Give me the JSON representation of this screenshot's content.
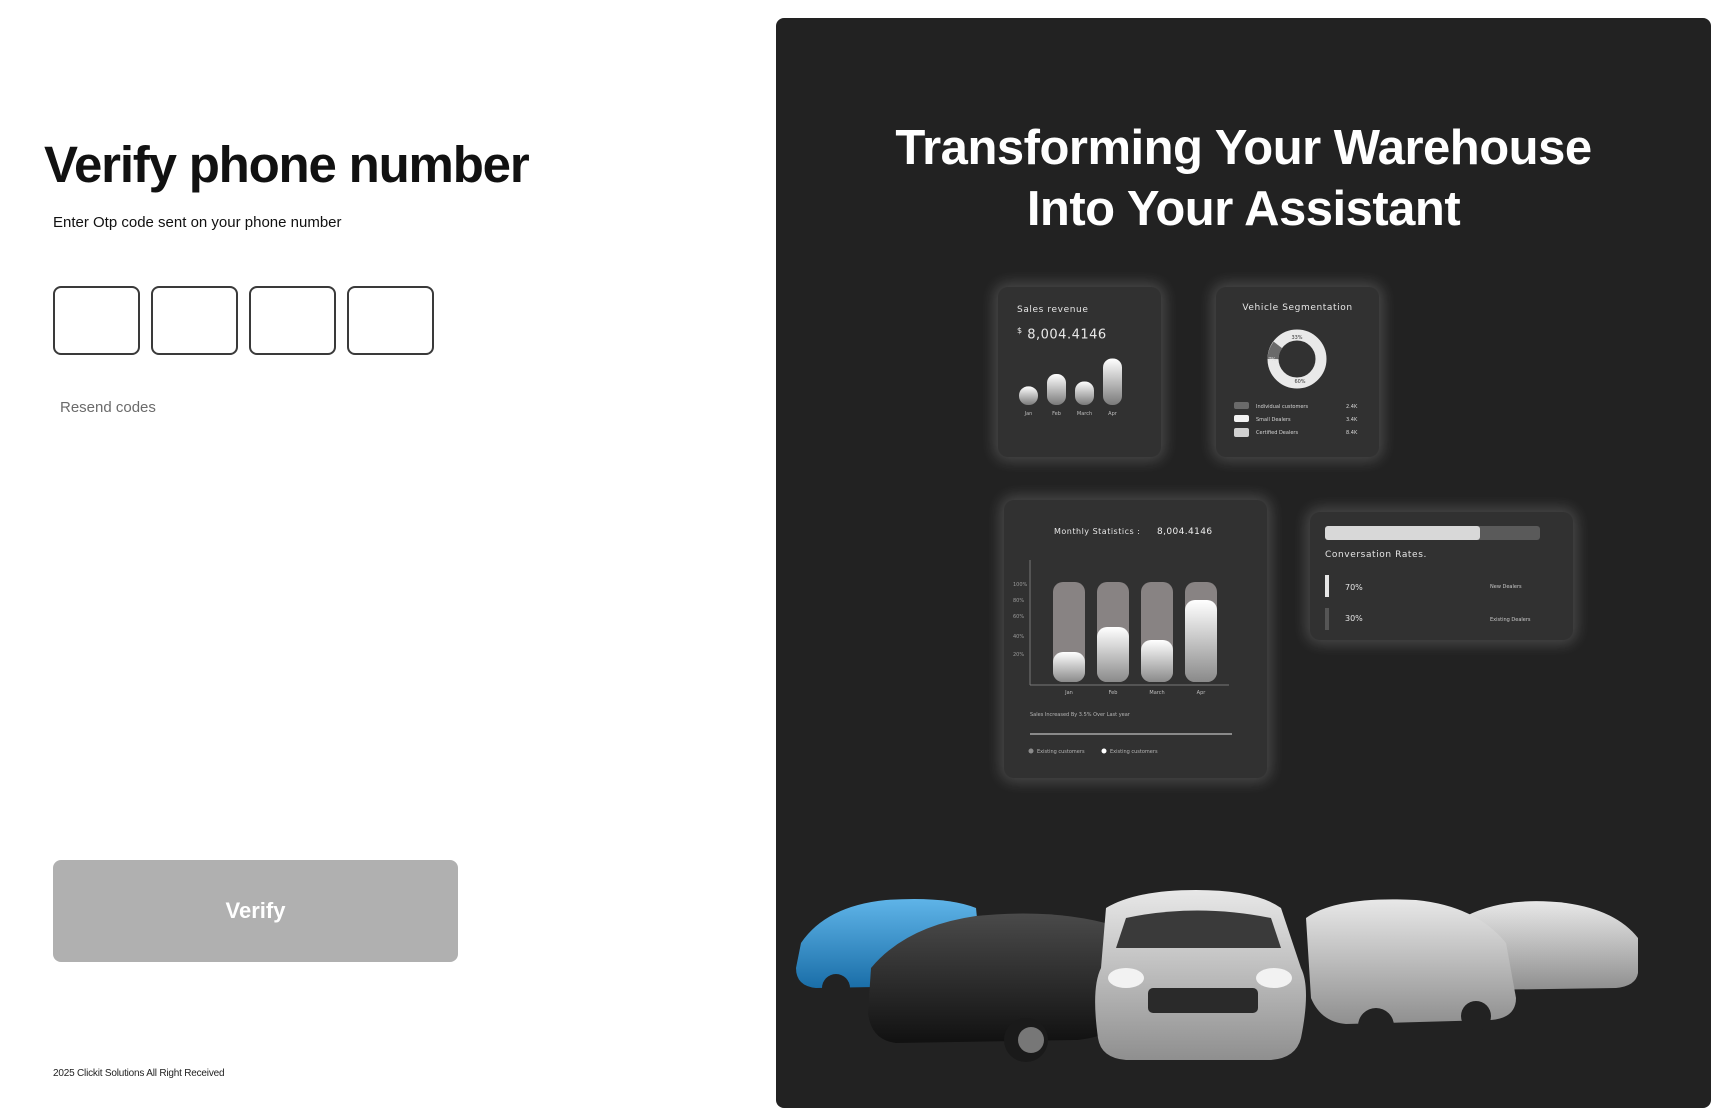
{
  "left": {
    "title": "Verify phone number",
    "subtitle": "Enter Otp code sent on your phone number",
    "otp_inputs": [
      "",
      "",
      "",
      ""
    ],
    "resend_label": "Resend codes",
    "verify_label": "Verify",
    "copyright": "2025 Clickit Solutions All Right Received"
  },
  "right": {
    "hero_line1": "Transforming Your Warehouse",
    "hero_line2": "Into Your Assistant",
    "sales_card": {
      "title": "Sales revenue",
      "currency": "$",
      "amount": "8,004.4146",
      "months": [
        "Jan",
        "Feb",
        "March",
        "Apr"
      ],
      "bar_values": [
        0.3,
        0.5,
        0.38,
        0.75
      ]
    },
    "segmentation_card": {
      "title": "Vehicle Segmentation",
      "donut_labels": [
        "33%",
        "7%",
        "60%"
      ],
      "legend": [
        {
          "label": "Individual customers",
          "value": "2.4K"
        },
        {
          "label": "Small Dealers",
          "value": "3.4K"
        },
        {
          "label": "Certified Dealers",
          "value": "8.4K"
        }
      ]
    },
    "monthly_card": {
      "title": "Monthly Statistics :",
      "amount": "8,004.4146",
      "y_ticks": [
        "100%",
        "80%",
        "60%",
        "40%",
        "20%"
      ],
      "months": [
        "Jan",
        "Feb",
        "March",
        "Apr"
      ],
      "fill_values": [
        0.3,
        0.55,
        0.42,
        0.82
      ],
      "note": "Sales Increased By 3.5% Over Last year",
      "legend": [
        "Existing customers",
        "Existing customers"
      ]
    },
    "conversion_card": {
      "title": "Conversation Rates.",
      "rows": [
        {
          "percent": "70%",
          "label": "New Dealers"
        },
        {
          "percent": "30%",
          "label": "Existing Dealers"
        }
      ],
      "progress_value": 0.72
    },
    "cars_image": "car-lineup-image"
  },
  "colors": {
    "dark_panel": "#222222",
    "card": "#313131",
    "button_disabled": "#b0b0b0"
  }
}
